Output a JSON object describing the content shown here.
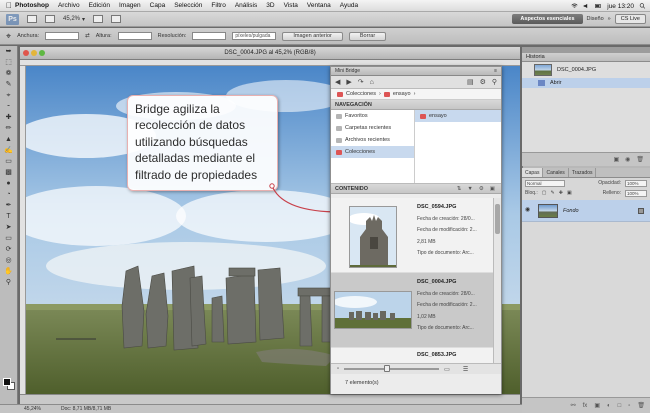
{
  "menubar": {
    "items": [
      "Photoshop",
      "Archivo",
      "Edición",
      "Imagen",
      "Capa",
      "Selección",
      "Filtro",
      "Análisis",
      "3D",
      "Vista",
      "Ventana",
      "Ayuda"
    ],
    "clock": "jue 13:20"
  },
  "appbar": {
    "logo": "Ps",
    "zoom": "45,2%",
    "workspace_active": "Aspectos esenciales",
    "workspace_other": "Diseño",
    "cs_live": "CS Live"
  },
  "options": {
    "width_label": "Anchura:",
    "height_label": "Altura:",
    "resolution_label": "Resolución:",
    "resolution_unit": "píxeles/pulgada",
    "front_image_button": "Imagen anterior",
    "clear_button": "Borrar"
  },
  "document": {
    "title": "DSC_0004.JPG al 45,2% (RGB/8)"
  },
  "callout": {
    "text": "Bridge agiliza la recolección de datos utilizando búsquedas detalladas mediante el filtrado de propiedades"
  },
  "bridge": {
    "panel_title": "Mini Bridge",
    "breadcrumb": [
      "Colecciones",
      "ensayo"
    ],
    "navigation_header": "NAVEGACIÓN",
    "nav_items": [
      "Favoritos",
      "Carpetas recientes",
      "Archivos recientes",
      "Colecciones"
    ],
    "nav_selected_index": 3,
    "collection_items": [
      "ensayo"
    ],
    "content_header": "CONTENIDO",
    "files": [
      {
        "name": "DSC_0594.JPG",
        "created_label": "Fecha de creación: 28/0...",
        "modified_label": "Fecha de modificación: 2...",
        "size": "2,81 MB",
        "type_label": "Tipo de documento: Arc..."
      },
      {
        "name": "DSC_0004.JPG",
        "created_label": "Fecha de creación: 28/0...",
        "modified_label": "Fecha de modificación: 2...",
        "size": "1,02 MB",
        "type_label": "Tipo de documento: Arc..."
      },
      {
        "name": "DSC_0853.JPG"
      }
    ],
    "status": "7 elemento(s)"
  },
  "history": {
    "tab": "Historia",
    "snapshot": "DSC_0004.JPG",
    "step": "Abrir"
  },
  "layers": {
    "tabs": [
      "Capas",
      "Canales",
      "Trazados"
    ],
    "blend_mode": "Normal",
    "opacity_label": "Opacidad:",
    "opacity": "100%",
    "lock_label": "Bloq.:",
    "fill_label": "Relleno:",
    "fill": "100%",
    "layer_name": "Fondo"
  },
  "status": {
    "zoom": "45,24%",
    "doc_info": "Doc: 8,71 MB/8,71 MB"
  }
}
